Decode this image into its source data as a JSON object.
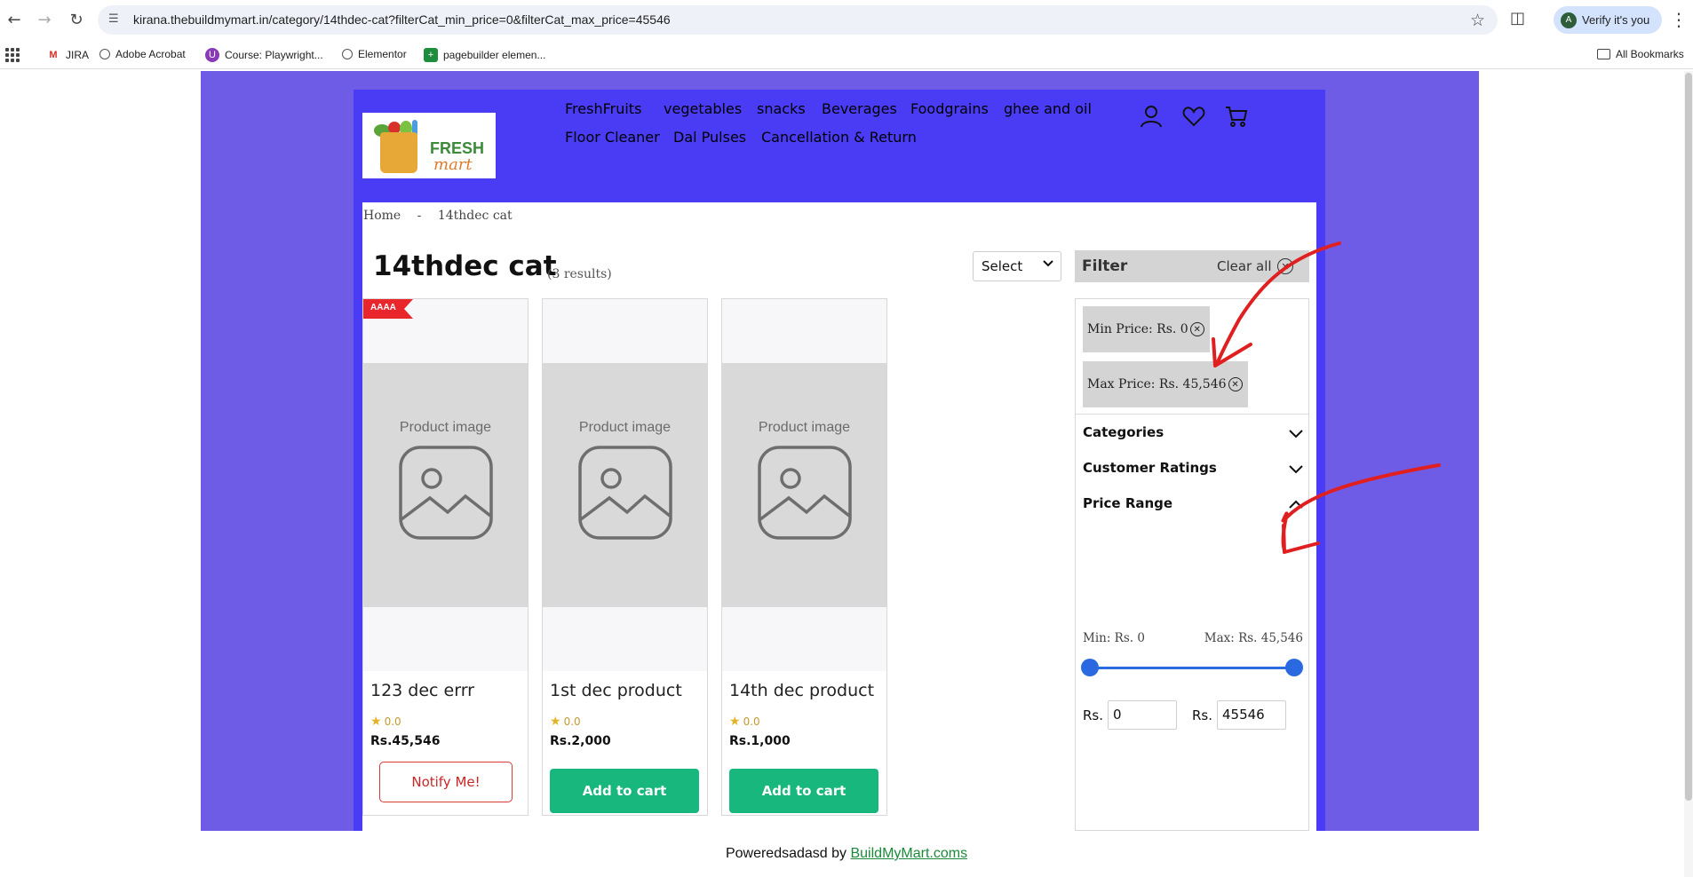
{
  "browser": {
    "url": "kirana.thebuildmymart.in/category/14thdec-cat?filterCat_min_price=0&filterCat_max_price=45546",
    "verify_label": "Verify it's you",
    "profile_initial": "A",
    "bookmarks": [
      "JIRA",
      "Adobe Acrobat",
      "Course: Playwright...",
      "Elementor",
      "pagebuilder elemen..."
    ],
    "all_bookmarks": "All Bookmarks"
  },
  "site": {
    "logo_text_1": "FRESH",
    "logo_text_2": "mart",
    "menu": [
      "FreshFruits",
      "vegetables",
      "snacks",
      "Beverages",
      "Foodgrains",
      "ghee and oil",
      "Floor Cleaner",
      "Dal Pulses",
      "Cancellation & Return"
    ]
  },
  "breadcrumb": {
    "home": "Home",
    "sep": "-",
    "current": "14thdec cat"
  },
  "category": {
    "title": "14thdec cat",
    "results": "(3 results)"
  },
  "sort": {
    "selected": "Select"
  },
  "products": [
    {
      "name": "123 dec errr",
      "rating": "0.0",
      "price": "Rs.45,546",
      "badge": "AAAA",
      "image_label": "Product image",
      "action": "Notify Me!"
    },
    {
      "name": "1st dec product",
      "rating": "0.0",
      "price": "Rs.2,000",
      "image_label": "Product image",
      "action": "Add to cart"
    },
    {
      "name": "14th dec product",
      "rating": "0.0",
      "price": "Rs.1,000",
      "image_label": "Product image",
      "action": "Add to cart"
    }
  ],
  "filter": {
    "title": "Filter",
    "clear_all": "Clear all",
    "chips": [
      "Min Price: Rs. 0",
      "Max Price: Rs. 45,546"
    ],
    "sections": [
      "Categories",
      "Customer Ratings",
      "Price Range"
    ],
    "range": {
      "min_label": "Min: Rs. 0",
      "max_label": "Max: Rs. 45,546",
      "currency": "Rs.",
      "min_value": "0",
      "max_value": "45546",
      "selected_min_fraction": 0,
      "selected_max_fraction": 1
    }
  },
  "footer": {
    "text": "Poweredsadasd by",
    "link": "BuildMyMart.coms"
  },
  "colors": {
    "accent": "#4a3cf5",
    "outer": "#6f5ce6",
    "cart_button": "#17b77d",
    "notify": "#c92727",
    "slider": "#2a69e0",
    "annotation": "#e02020"
  }
}
